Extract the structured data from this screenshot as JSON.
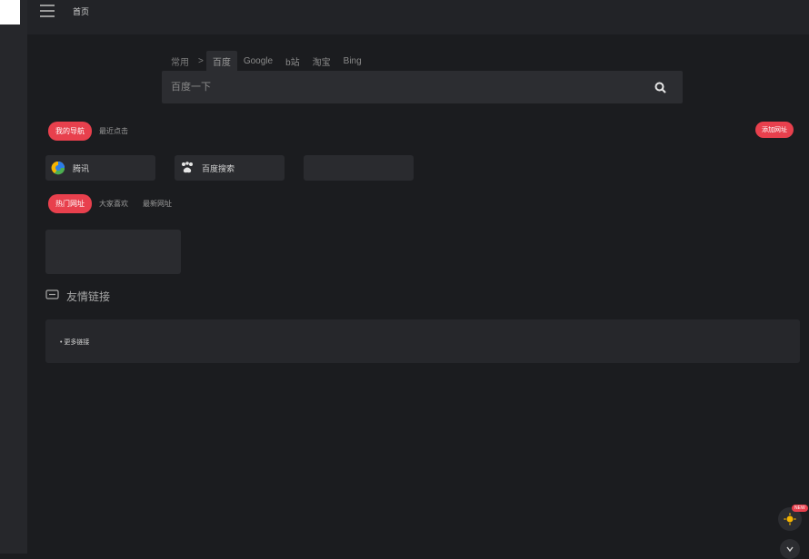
{
  "topbar": {
    "title": "首页"
  },
  "search": {
    "tabs": [
      {
        "label": "常用"
      },
      {
        "label": ">"
      },
      {
        "label": "百度"
      },
      {
        "label": "Google"
      },
      {
        "label": "b站"
      },
      {
        "label": "淘宝"
      },
      {
        "label": "Bing"
      }
    ],
    "placeholder": "百度一下"
  },
  "nav_tabs": [
    {
      "label": "我的导航"
    },
    {
      "label": "最近点击"
    }
  ],
  "add_site": "添加网址",
  "sites": [
    {
      "label": "腾讯"
    },
    {
      "label": "百度搜索"
    },
    {
      "label": ""
    }
  ],
  "hot_tabs": [
    {
      "label": "热门网址"
    },
    {
      "label": "大家喜欢"
    },
    {
      "label": "最新网址"
    }
  ],
  "friends": {
    "title": "友情链接",
    "more": "• 更多链接"
  },
  "fab": {
    "badge": "NEW"
  },
  "colors": {
    "accent": "#e8404d",
    "background": "#1b1c1f",
    "panel": "#2a2b2f"
  },
  "icons": [
    "menu-icon",
    "search-icon",
    "tencent-icon",
    "baidu-icon",
    "link-icon",
    "theme-icon",
    "arrow-down-icon"
  ]
}
